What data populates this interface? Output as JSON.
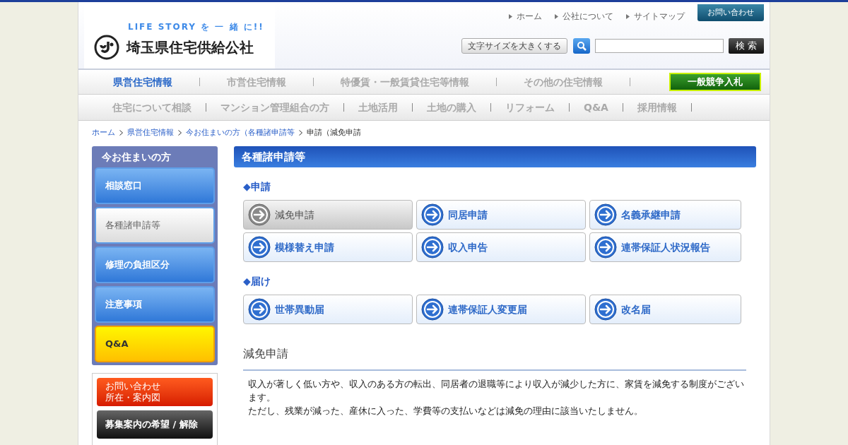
{
  "header": {
    "tagline": "LIFE STORY を 一 緒 に!!",
    "site_name": "埼玉県住宅供給公社",
    "top_links": [
      "ホーム",
      "公社について",
      "サイトマップ"
    ],
    "contact_button": "お問い合わせ",
    "font_size_button": "文字サイズを大きくする",
    "search_button": "検 索"
  },
  "nav_primary": [
    {
      "label": "県営住宅情報",
      "selected": true
    },
    {
      "label": "市営住宅情報",
      "selected": false
    },
    {
      "label": "特優賃・一般賃貸住宅等情報",
      "selected": false
    },
    {
      "label": "その他の住宅情報",
      "selected": false
    }
  ],
  "bid_button": "一般競争入札",
  "nav_secondary": [
    "住宅について相談",
    "マンション管理組合の方",
    "土地活用",
    "土地の購入",
    "リフォーム",
    "Q&A",
    "採用情報"
  ],
  "breadcrumb": [
    {
      "label": "ホーム",
      "link": true
    },
    {
      "label": "県営住宅情報",
      "link": true
    },
    {
      "label": "今お住まいの方（各種諸申請等",
      "link": true
    },
    {
      "label": "申請（減免申請",
      "link": false
    }
  ],
  "sidebar": {
    "title": "今お住まいの方",
    "items": [
      {
        "label": "相談窓口",
        "kind": "blue",
        "selected": false
      },
      {
        "label": "各種諸申請等",
        "kind": "blue",
        "selected": true
      },
      {
        "label": "修理の負担区分",
        "kind": "blue",
        "selected": false
      },
      {
        "label": "注意事項",
        "kind": "blue",
        "selected": false
      },
      {
        "label": "Q&A",
        "kind": "yellow",
        "selected": false
      }
    ],
    "extra_buttons": [
      {
        "lines": [
          "お問い合わせ",
          "所在・案内図"
        ],
        "kind": "red"
      },
      {
        "lines": [
          "募集案内の希望 / 解除"
        ],
        "kind": "dark"
      }
    ]
  },
  "main": {
    "title": "各種諸申請等",
    "groups": [
      {
        "heading": "◆申請",
        "buttons": [
          {
            "label": "減免申請",
            "selected": true
          },
          {
            "label": "同居申請",
            "selected": false
          },
          {
            "label": "名義承継申請",
            "selected": false
          },
          {
            "label": "模様替え申請",
            "selected": false
          },
          {
            "label": "収入申告",
            "selected": false
          },
          {
            "label": "連帯保証人状況報告",
            "selected": false
          }
        ]
      },
      {
        "heading": "◆届け",
        "buttons": [
          {
            "label": "世帯異動届",
            "selected": false
          },
          {
            "label": "連帯保証人変更届",
            "selected": false
          },
          {
            "label": "改名届",
            "selected": false
          }
        ]
      }
    ],
    "section_title": "減免申請",
    "paragraphs": [
      "収入が著しく低い方や、収入のある方の転出、同居者の退職等により収入が減少した方に、家賃を減免する制度がございます。",
      "ただし、残業が減った、産休に入った、学費等の支払いなどは減免の理由に該当いたしません。"
    ]
  }
}
